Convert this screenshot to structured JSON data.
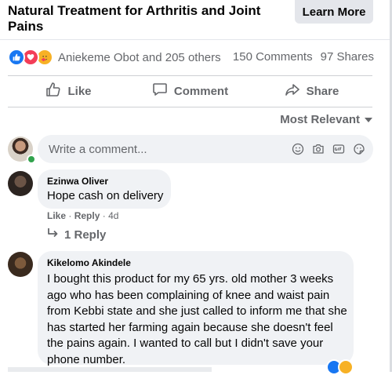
{
  "post": {
    "headline": "Natural Treatment for Arthritis and Joint Pains",
    "cta_label": "Learn More"
  },
  "reactions": {
    "names": "Aniekeme Obot and 205 others",
    "comments": "150 Comments",
    "shares": "97 Shares",
    "icons": [
      "like-reaction-icon",
      "love-reaction-icon",
      "care-reaction-icon"
    ],
    "colors": {
      "like": "#1877f2",
      "love": "#f33e58",
      "care": "#f7b125"
    }
  },
  "actions": {
    "like": "Like",
    "comment": "Comment",
    "share": "Share"
  },
  "sort": {
    "label": "Most Relevant"
  },
  "composer": {
    "placeholder": "Write a comment...",
    "icons": [
      "emoji-icon",
      "camera-icon",
      "gif-icon",
      "sticker-icon"
    ]
  },
  "comments": [
    {
      "author": "Ezinwa Oliver",
      "text": "Hope cash on delivery",
      "like": "Like",
      "reply": "Reply",
      "time": "4d",
      "replies_label": "1 Reply"
    },
    {
      "author": "Kikelomo Akindele",
      "text": "I bought this product for my 65 yrs. old mother 3 weeks ago who has been complaining of knee and waist pain from Kebbi state and she just called to inform me that she has started her farming again because she doesn't feel the pains again. I wanted to call but I didn't save your phone number."
    }
  ]
}
